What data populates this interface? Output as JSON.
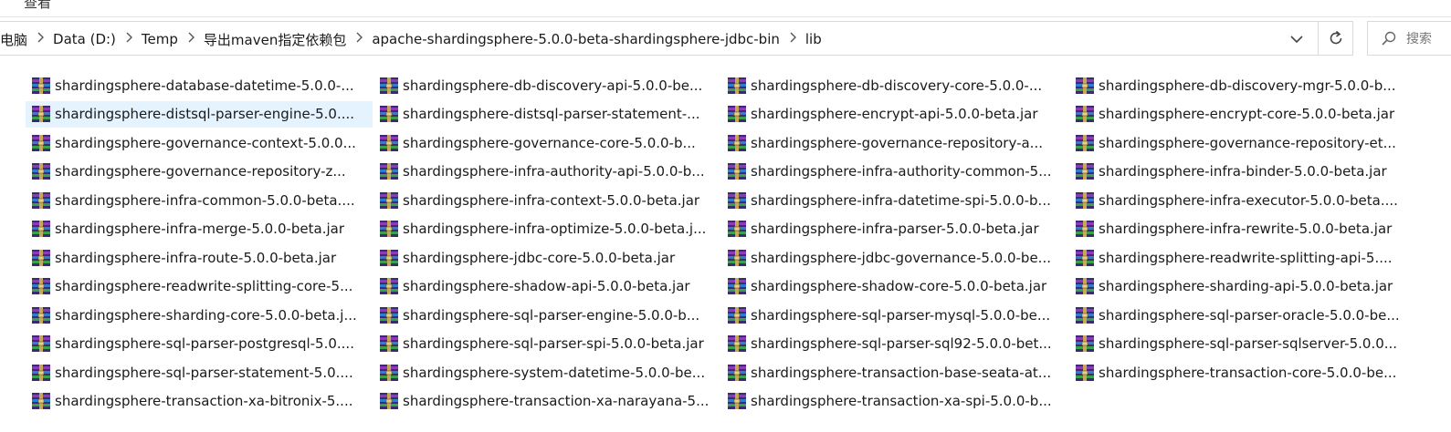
{
  "ribbon": {
    "tab_label": "查看"
  },
  "address_bar": {
    "crumbs": [
      "此电脑",
      "Data (D:)",
      "Temp",
      "导出maven指定依赖包",
      "apache-shardingsphere-5.0.0-beta-shardingsphere-jdbc-bin",
      "lib"
    ],
    "separator_icon": "chevron-right-icon"
  },
  "search": {
    "placeholder": "搜索"
  },
  "file_icon": "winrar-archive-icon",
  "files": [
    [
      "shardingsphere-database-datetime-5.0.0-...",
      "shardingsphere-db-discovery-api-5.0.0-be...",
      "shardingsphere-db-discovery-core-5.0.0-...",
      "shardingsphere-db-discovery-mgr-5.0.0-b..."
    ],
    [
      "shardingsphere-distsql-parser-engine-5.0....",
      "shardingsphere-distsql-parser-statement-...",
      "shardingsphere-encrypt-api-5.0.0-beta.jar",
      "shardingsphere-encrypt-core-5.0.0-beta.jar"
    ],
    [
      "shardingsphere-governance-context-5.0.0...",
      "shardingsphere-governance-core-5.0.0-b...",
      "shardingsphere-governance-repository-a...",
      "shardingsphere-governance-repository-et..."
    ],
    [
      "shardingsphere-governance-repository-z...",
      "shardingsphere-infra-authority-api-5.0.0-b...",
      "shardingsphere-infra-authority-common-5...",
      "shardingsphere-infra-binder-5.0.0-beta.jar"
    ],
    [
      "shardingsphere-infra-common-5.0.0-beta....",
      "shardingsphere-infra-context-5.0.0-beta.jar",
      "shardingsphere-infra-datetime-spi-5.0.0-b...",
      "shardingsphere-infra-executor-5.0.0-beta...."
    ],
    [
      "shardingsphere-infra-merge-5.0.0-beta.jar",
      "shardingsphere-infra-optimize-5.0.0-beta.j...",
      "shardingsphere-infra-parser-5.0.0-beta.jar",
      "shardingsphere-infra-rewrite-5.0.0-beta.jar"
    ],
    [
      "shardingsphere-infra-route-5.0.0-beta.jar",
      "shardingsphere-jdbc-core-5.0.0-beta.jar",
      "shardingsphere-jdbc-governance-5.0.0-be...",
      "shardingsphere-readwrite-splitting-api-5...."
    ],
    [
      "shardingsphere-readwrite-splitting-core-5...",
      "shardingsphere-shadow-api-5.0.0-beta.jar",
      "shardingsphere-shadow-core-5.0.0-beta.jar",
      "shardingsphere-sharding-api-5.0.0-beta.jar"
    ],
    [
      "shardingsphere-sharding-core-5.0.0-beta.j...",
      "shardingsphere-sql-parser-engine-5.0.0-b...",
      "shardingsphere-sql-parser-mysql-5.0.0-be...",
      "shardingsphere-sql-parser-oracle-5.0.0-be..."
    ],
    [
      "shardingsphere-sql-parser-postgresql-5.0....",
      "shardingsphere-sql-parser-spi-5.0.0-beta.jar",
      "shardingsphere-sql-parser-sql92-5.0.0-bet...",
      "shardingsphere-sql-parser-sqlserver-5.0.0..."
    ],
    [
      "shardingsphere-sql-parser-statement-5.0....",
      "shardingsphere-system-datetime-5.0.0-be...",
      "shardingsphere-transaction-base-seata-at...",
      "shardingsphere-transaction-core-5.0.0-be..."
    ],
    [
      "shardingsphere-transaction-xa-bitronix-5....",
      "shardingsphere-transaction-xa-narayana-5...",
      "shardingsphere-transaction-xa-spi-5.0.0-b...",
      ""
    ]
  ],
  "selected": {
    "row": 1,
    "col": 0
  }
}
